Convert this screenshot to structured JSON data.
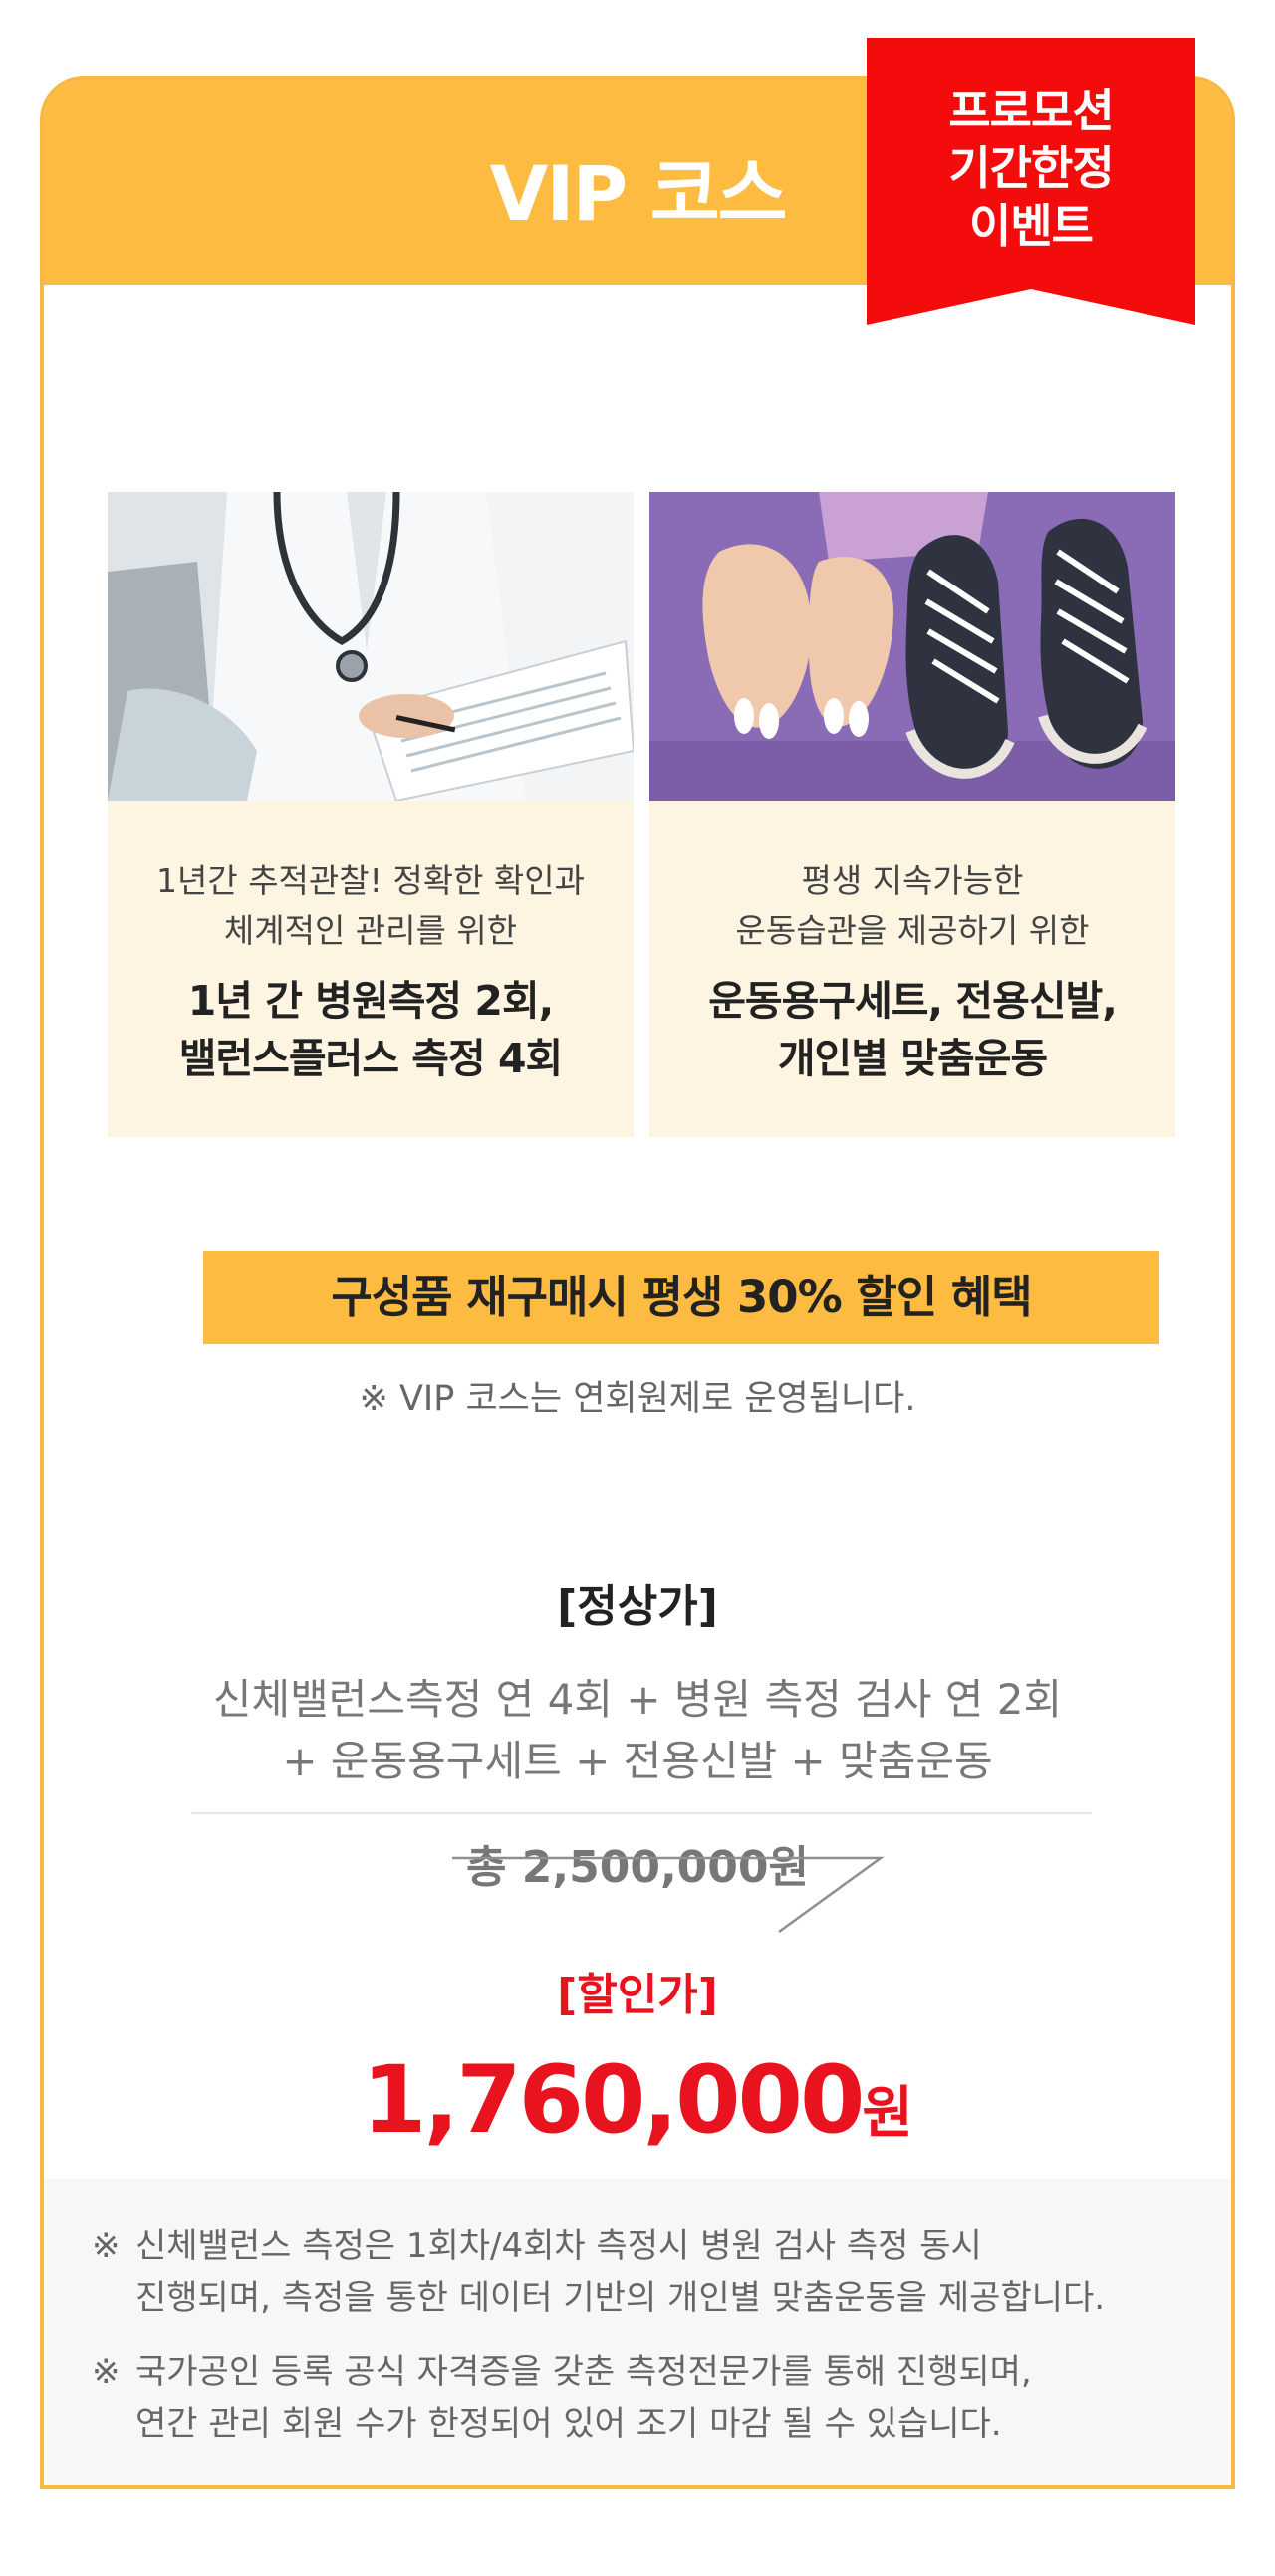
{
  "header": {
    "title": "VIP 코스",
    "ribbon_lines": [
      "프로모션",
      "기간한정",
      "이벤트"
    ]
  },
  "features": [
    {
      "image": "doctor-with-stethoscope-writing-photo",
      "sub_lines": [
        "1년간 추적관찰! 정확한 확인과",
        "체계적인 관리를 위한"
      ],
      "main_lines": [
        "1년 간 병원측정 2회,",
        "밸런스플러스 측정 4회"
      ]
    },
    {
      "image": "feet-with-toe-spacers-and-sneakers-photo",
      "sub_lines": [
        "평생 지속가능한",
        "운동습관을 제공하기 위한"
      ],
      "main_lines": [
        "운동용구세트, 전용신발,",
        "개인별 맞춤운동"
      ]
    }
  ],
  "promo": {
    "banner": "구성품 재구매시 평생 30% 할인 혜택",
    "membership_note": "※ VIP 코스는 연회원제로 운영됩니다."
  },
  "pricing": {
    "regular_label": "[정상가]",
    "regular_desc_lines": [
      "신체밸런스측정 연 4회 + 병원 측정 검사 연 2회",
      "+ 운동용구세트 + 전용신발 + 맞춤운동"
    ],
    "regular_total": "총 2,500,000원",
    "sale_label": "[할인가]",
    "sale_amount": "1,760,000",
    "sale_unit": "원"
  },
  "notes": [
    {
      "mark": "※",
      "lines": [
        "신체밸런스 측정은  1회차/4회차 측정시 병원 검사 측정 동시",
        "진행되며, 측정을 통한 데이터 기반의 개인별 맞춤운동을 제공합니다."
      ]
    },
    {
      "mark": "※",
      "lines": [
        "국가공인 등록 공식 자격증을 갖춘 측정전문가를 통해 진행되며,",
        "연간 관리 회원 수가  한정되어 있어 조기 마감 될 수 있습니다."
      ]
    }
  ],
  "colors": {
    "accent_yellow": "#fdbb41",
    "ribbon_red": "#f40b0b",
    "sale_red": "#e8131e",
    "feature_bg": "#fef4e2"
  }
}
